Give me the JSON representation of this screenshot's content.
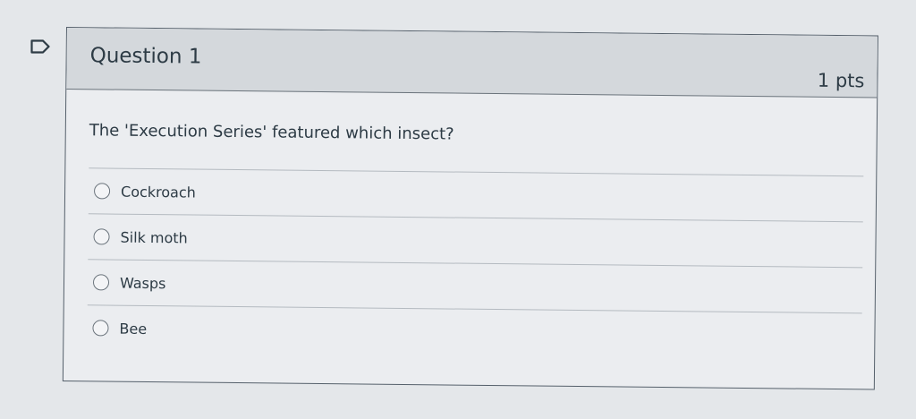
{
  "question": {
    "title": "Question 1",
    "points": "1 pts",
    "text": "The 'Execution Series' featured which insect?",
    "answers": [
      {
        "label": "Cockroach"
      },
      {
        "label": "Silk moth"
      },
      {
        "label": "Wasps"
      },
      {
        "label": "Bee"
      }
    ]
  },
  "icons": {
    "flag": "flag-icon"
  }
}
